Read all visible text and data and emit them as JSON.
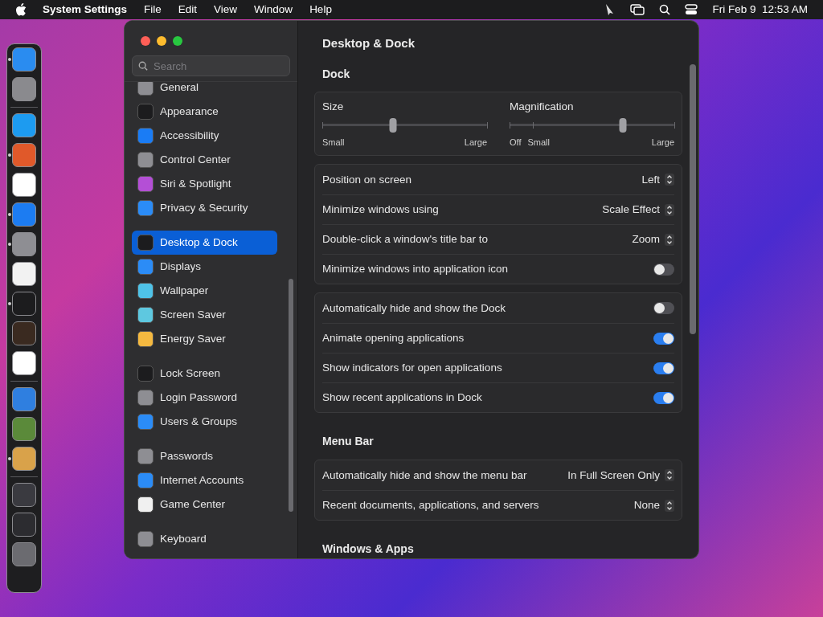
{
  "menu_bar": {
    "app": "System Settings",
    "menus": [
      "File",
      "Edit",
      "View",
      "Window",
      "Help"
    ],
    "clock": "Fri Feb 9  12:53 AM"
  },
  "dock": {
    "items": [
      {
        "kind": "app",
        "color": "#2a8cf0",
        "running": true
      },
      {
        "kind": "app",
        "color": "#8a8a8e",
        "running": false
      },
      {
        "kind": "separator"
      },
      {
        "kind": "app",
        "color": "#1d9bf0",
        "running": false
      },
      {
        "kind": "app",
        "color": "#e0592a",
        "running": true
      },
      {
        "kind": "app",
        "color": "#ffffff",
        "running": false
      },
      {
        "kind": "app",
        "color": "#1c7cf2",
        "running": true
      },
      {
        "kind": "app",
        "color": "#8e8e93",
        "running": true
      },
      {
        "kind": "app",
        "color": "#f2f2f2",
        "running": false
      },
      {
        "kind": "app",
        "color": "#1c1c1e",
        "running": true
      },
      {
        "kind": "app",
        "color": "#3a2a20",
        "running": false
      },
      {
        "kind": "app",
        "color": "#ffffff",
        "running": false
      },
      {
        "kind": "separator"
      },
      {
        "kind": "app",
        "color": "#2f7fe0",
        "running": false
      },
      {
        "kind": "app",
        "color": "#5b8a3a",
        "running": false
      },
      {
        "kind": "app",
        "color": "#d9a24a",
        "running": true
      },
      {
        "kind": "separator"
      },
      {
        "kind": "app",
        "color": "#3a3a40",
        "running": false
      },
      {
        "kind": "app",
        "color": "#2c2c30",
        "running": false
      },
      {
        "kind": "app",
        "color": "#6b6b70",
        "running": false
      }
    ]
  },
  "window": {
    "search": {
      "placeholder": "Search"
    },
    "sidebar": {
      "groups": [
        [
          {
            "label": "General",
            "color": "#8e8e93",
            "selected": false
          },
          {
            "label": "Appearance",
            "color": "#1c1c1e",
            "selected": false
          },
          {
            "label": "Accessibility",
            "color": "#1a7cf5",
            "selected": false
          },
          {
            "label": "Control Center",
            "color": "#8e8e93",
            "selected": false
          },
          {
            "label": "Siri & Spotlight",
            "color": "#b44fd6",
            "selected": false
          },
          {
            "label": "Privacy & Security",
            "color": "#2b8cf7",
            "selected": false
          }
        ],
        [
          {
            "label": "Desktop & Dock",
            "color": "#1c1c1e",
            "selected": true
          },
          {
            "label": "Displays",
            "color": "#2b8cf7",
            "selected": false
          },
          {
            "label": "Wallpaper",
            "color": "#4fc3e8",
            "selected": false
          },
          {
            "label": "Screen Saver",
            "color": "#5ec8e0",
            "selected": false
          },
          {
            "label": "Energy Saver",
            "color": "#f5b940",
            "selected": false
          }
        ],
        [
          {
            "label": "Lock Screen",
            "color": "#1c1c1e",
            "selected": false
          },
          {
            "label": "Login Password",
            "color": "#8e8e93",
            "selected": false
          },
          {
            "label": "Users & Groups",
            "color": "#2b8cf7",
            "selected": false
          }
        ],
        [
          {
            "label": "Passwords",
            "color": "#8e8e93",
            "selected": false
          },
          {
            "label": "Internet Accounts",
            "color": "#2b8cf7",
            "selected": false
          },
          {
            "label": "Game Center",
            "color": "#f0f0f0",
            "selected": false
          }
        ],
        [
          {
            "label": "Keyboard",
            "color": "#8e8e93",
            "selected": false
          }
        ]
      ]
    },
    "title": "Desktop & Dock",
    "sections": [
      {
        "heading": "Dock",
        "cards": [
          {
            "kind": "sliders",
            "sliders": [
              {
                "label": "Size",
                "level": 0.43,
                "ticks": [
                  "Small",
                  "Large"
                ]
              },
              {
                "label": "Magnification",
                "level": 0.69,
                "ticks": [
                  "Off",
                  "Small",
                  "Large"
                ]
              }
            ]
          },
          {
            "kind": "rows",
            "rows": [
              {
                "kind": "popup",
                "label": "Position on screen",
                "value": "Left"
              },
              {
                "kind": "popup",
                "label": "Minimize windows using",
                "value": "Scale Effect"
              },
              {
                "kind": "popup",
                "label": "Double-click a window's title bar to",
                "value": "Zoom"
              },
              {
                "kind": "toggle",
                "label": "Minimize windows into application icon",
                "on": false
              }
            ]
          },
          {
            "kind": "rows",
            "rows": [
              {
                "kind": "toggle",
                "label": "Automatically hide and show the Dock",
                "on": false
              },
              {
                "kind": "toggle",
                "label": "Animate opening applications",
                "on": true
              },
              {
                "kind": "toggle",
                "label": "Show indicators for open applications",
                "on": true
              },
              {
                "kind": "toggle",
                "label": "Show recent applications in Dock",
                "on": true
              }
            ]
          }
        ]
      },
      {
        "heading": "Menu Bar",
        "cards": [
          {
            "kind": "rows",
            "rows": [
              {
                "kind": "popup",
                "label": "Automatically hide and show the menu bar",
                "value": "In Full Screen Only"
              },
              {
                "kind": "popup",
                "label": "Recent documents, applications, and servers",
                "value": "None"
              }
            ]
          }
        ]
      },
      {
        "heading": "Windows & Apps",
        "cards": [
          {
            "kind": "rows"
          }
        ]
      }
    ]
  }
}
